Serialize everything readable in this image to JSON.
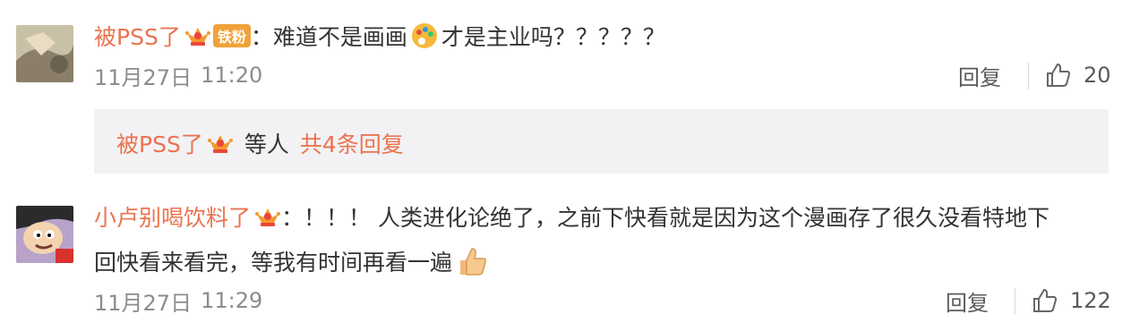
{
  "comments": [
    {
      "username": "被PSS了",
      "badge": "铁粉",
      "separator": "：",
      "text_before_emoji": "难道不是画画",
      "emoji": "palette-emoji",
      "text_after_emoji": "才是主业吗？？？？？",
      "date": "11月27日",
      "time": "11:20",
      "reply_label": "回复",
      "likes": "20",
      "replies_preview": {
        "username": "被PSS了",
        "suffix": "等人",
        "link": "共4条回复"
      }
    },
    {
      "username": "小卢别喝饮料了",
      "separator": "：",
      "line1": "！！！ 人类进化论绝了，之前下快看就是因为这个漫画存了很久没看特地下",
      "line2": "回快看来看完，等我有时间再看一遍",
      "emoji": "thumbs-up-emoji",
      "date": "11月27日",
      "time": "11:29",
      "reply_label": "回复",
      "likes": "122"
    }
  ],
  "colors": {
    "username": "#eb7350",
    "text": "#333333",
    "muted": "#8c8c8c",
    "reply_bg": "#f2f2f5",
    "badge": "#f0a23a"
  }
}
